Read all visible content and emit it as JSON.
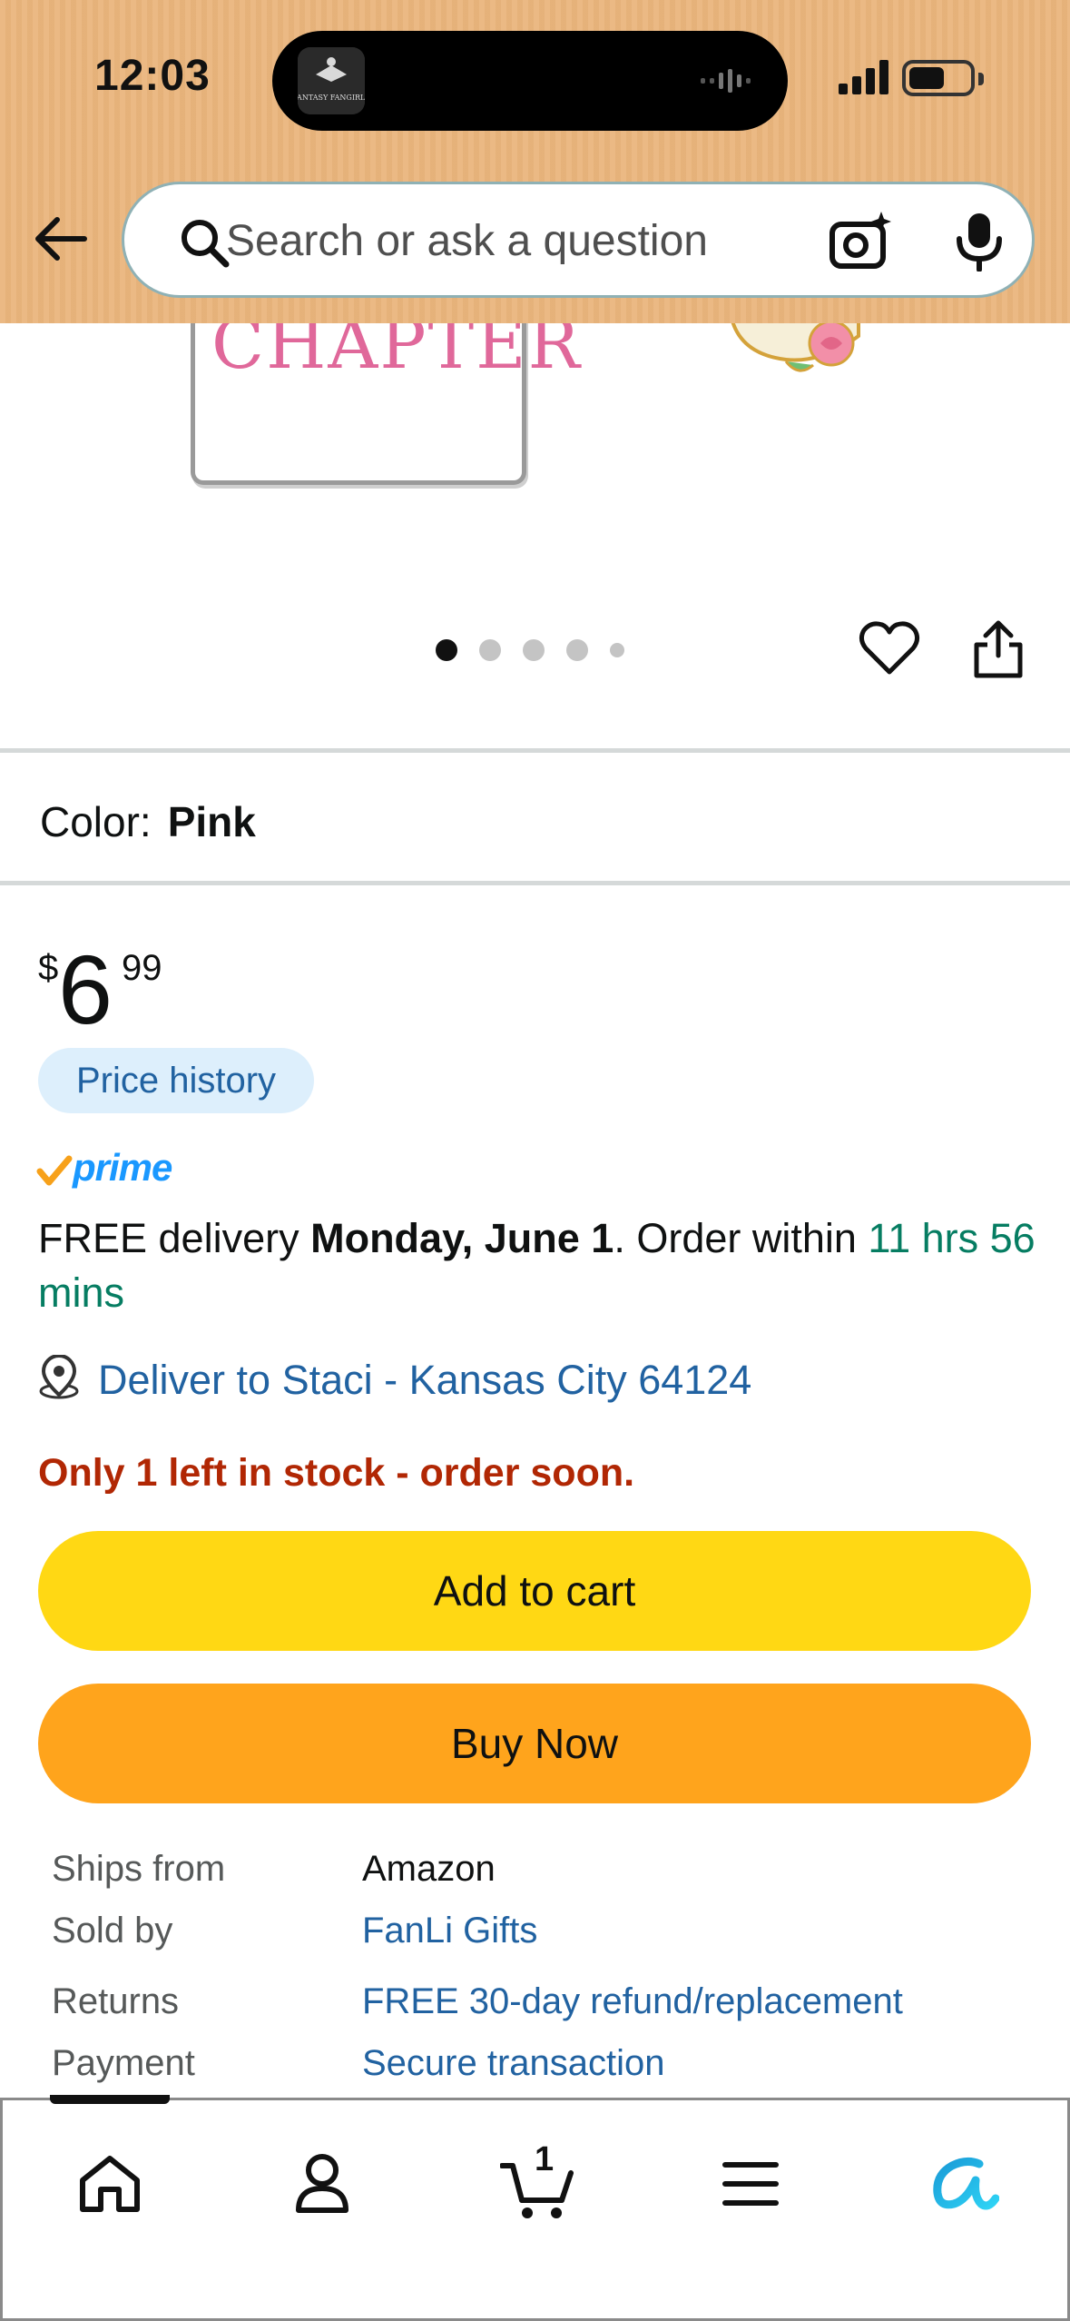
{
  "status_bar": {
    "time": "12:03",
    "island_app_text": "FANTASY FANGIRLS"
  },
  "search": {
    "placeholder": "Search or ask a question"
  },
  "product_image": {
    "card_text": "CHAPTER"
  },
  "image_dots": {
    "count": 5,
    "active_index": 0
  },
  "color": {
    "label": "Color:",
    "value": "Pink"
  },
  "price": {
    "currency": "$",
    "whole": "6",
    "fraction": "99"
  },
  "price_history_label": "Price history",
  "prime_label": "prime",
  "delivery": {
    "prefix": "FREE delivery ",
    "date": "Monday, June 1",
    "middle": ". Order within ",
    "countdown": "11 hrs 56 mins"
  },
  "deliver_to": "Deliver to Staci - Kansas City 64124",
  "stock_message": "Only 1 left in stock - order soon.",
  "buttons": {
    "add_to_cart": "Add to cart",
    "buy_now": "Buy Now"
  },
  "info": [
    {
      "key": "Ships from",
      "value": "Amazon",
      "link": false
    },
    {
      "key": "Sold by",
      "value": "FanLi Gifts",
      "link": true
    },
    {
      "key": "Returns",
      "value": "FREE 30-day refund/replacement",
      "link": true
    },
    {
      "key": "Payment",
      "value": "Secure transaction",
      "link": true
    }
  ],
  "tabbar": {
    "cart_count": "1",
    "items": [
      "home-icon",
      "account-icon",
      "cart-icon",
      "menu-icon",
      "rufus-icon"
    ]
  },
  "colors": {
    "header_bg": "#eab57c",
    "add_to_cart": "#ffd814",
    "buy_now": "#ffa41c",
    "link": "#2162a1",
    "stock_red": "#b12704",
    "green": "#067d62",
    "prime_blue": "#1a98ff"
  }
}
